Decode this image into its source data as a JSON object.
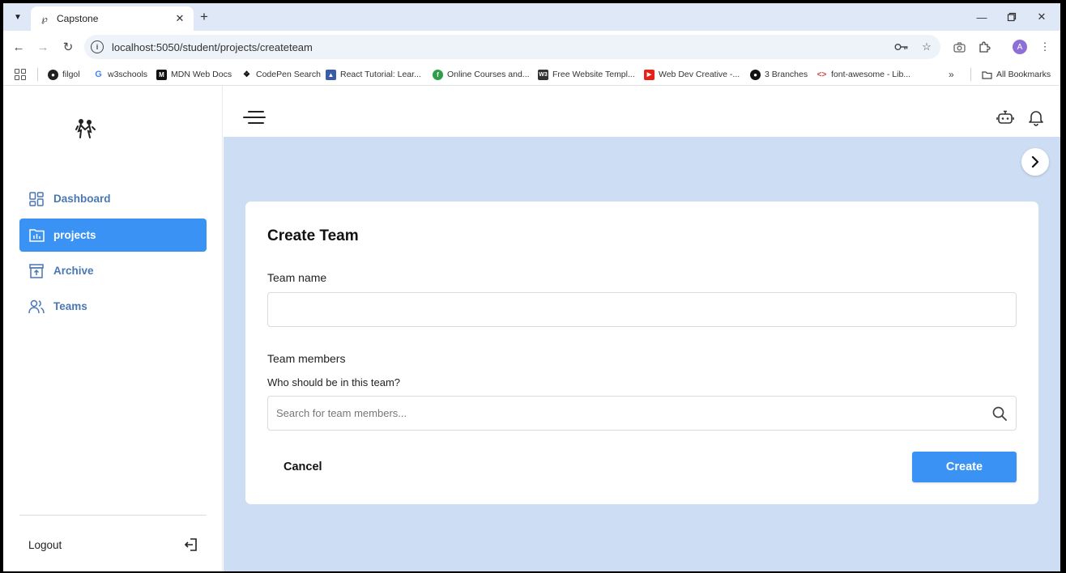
{
  "browser": {
    "tab_title": "Capstone",
    "url": "localhost:5050/student/projects/createteam",
    "profile_initial": "A",
    "bookmarks": [
      {
        "label": "filgol",
        "icon": "filgol-favicon",
        "color": "#222222"
      },
      {
        "label": "w3schools",
        "icon": "google-favicon",
        "color": "#ffffff"
      },
      {
        "label": "MDN Web Docs",
        "icon": "mdn-favicon",
        "color": "#111111"
      },
      {
        "label": "CodePen Search",
        "icon": "codepen-favicon",
        "color": "#111111"
      },
      {
        "label": "React Tutorial: Lear...",
        "icon": "react-favicon",
        "color": "#3b5aa8"
      },
      {
        "label": "Online Courses and...",
        "icon": "courses-favicon",
        "color": "#2e9e48"
      },
      {
        "label": "Free Website Templ...",
        "icon": "w3-favicon",
        "color": "#333333"
      },
      {
        "label": "Web Dev Creative -...",
        "icon": "youtube-favicon",
        "color": "#e62117"
      },
      {
        "label": "3 Branches",
        "icon": "github-favicon",
        "color": "#111111"
      },
      {
        "label": "font-awesome - Lib...",
        "icon": "code-favicon",
        "color": "#ffffff"
      }
    ],
    "all_bookmarks": "All Bookmarks"
  },
  "sidebar": {
    "items": [
      {
        "label": "Dashboard",
        "icon": "dashboard-icon"
      },
      {
        "label": "projects",
        "icon": "folder-chart-icon",
        "active": true
      },
      {
        "label": "Archive",
        "icon": "archive-icon"
      },
      {
        "label": "Teams",
        "icon": "users-icon"
      }
    ],
    "logout": "Logout"
  },
  "form": {
    "title": "Create Team",
    "team_name_label": "Team name",
    "team_name_value": "",
    "members_label": "Team members",
    "members_sublabel": "Who should be in this team?",
    "members_placeholder": "Search for team members...",
    "cancel": "Cancel",
    "create": "Create"
  },
  "colors": {
    "accent": "#3a93f4",
    "content_bg": "#cdddf3",
    "nav_text": "#4a77b3"
  }
}
